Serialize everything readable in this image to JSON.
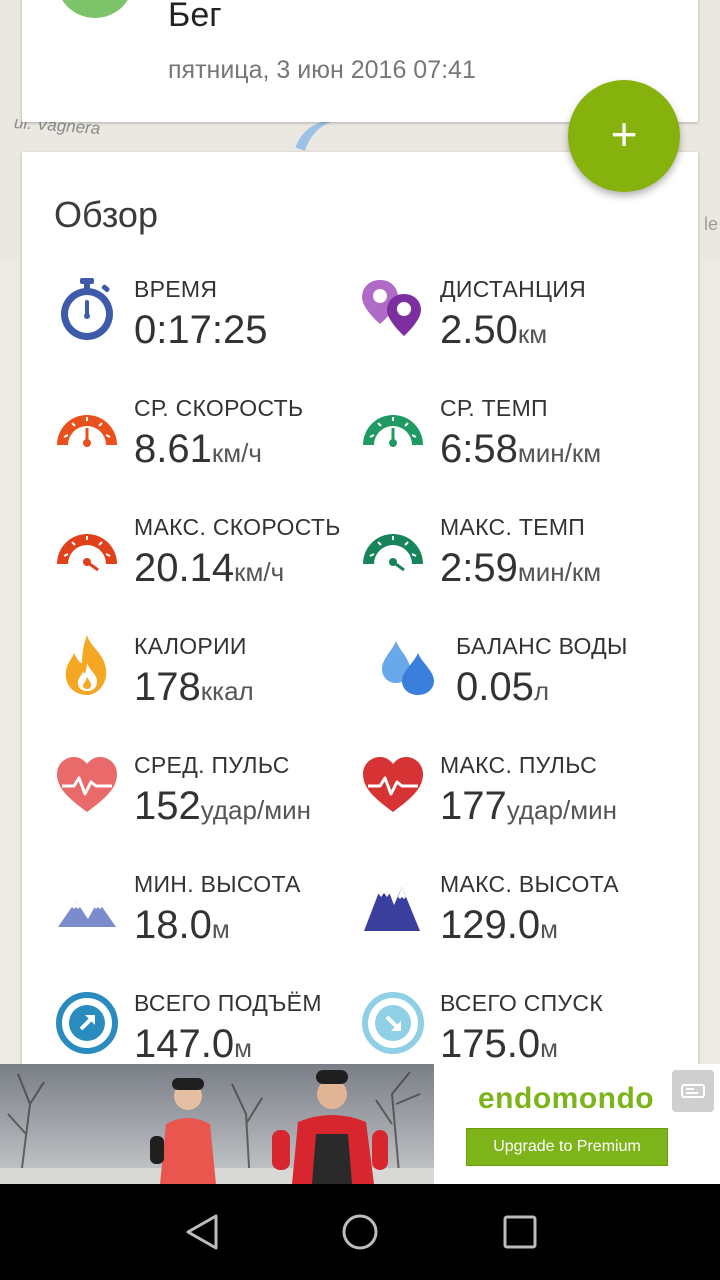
{
  "map": {
    "road_label": "ul. Vagnera",
    "edge_label": "le"
  },
  "header": {
    "sport": "Бег",
    "date": "пятница, 3 июн 2016 07:41"
  },
  "fab": {
    "label": "+"
  },
  "overview": {
    "title": "Обзор",
    "stats": [
      {
        "id": "time",
        "label": "ВРЕМЯ",
        "value": "0:17:25",
        "unit": "",
        "icon": "stopwatch-icon"
      },
      {
        "id": "distance",
        "label": "ДИСТАНЦИЯ",
        "value": "2.50",
        "unit": "км",
        "icon": "location-pins-icon"
      },
      {
        "id": "avg_speed",
        "label": "СР. СКОРОСТЬ",
        "value": "8.61",
        "unit": "км/ч",
        "icon": "speedometer-icon"
      },
      {
        "id": "avg_pace",
        "label": "СР. ТЕМП",
        "value": "6:58",
        "unit": "мин/км",
        "icon": "pace-gauge-icon"
      },
      {
        "id": "max_speed",
        "label": "МАКС. СКОРОСТЬ",
        "value": "20.14",
        "unit": "км/ч",
        "icon": "max-speedometer-icon"
      },
      {
        "id": "max_pace",
        "label": "МАКС. ТЕМП",
        "value": "2:59",
        "unit": "мин/км",
        "icon": "max-pace-gauge-icon"
      },
      {
        "id": "calories",
        "label": "КАЛОРИИ",
        "value": "178",
        "unit": "ккал",
        "icon": "flame-icon"
      },
      {
        "id": "water",
        "label": "БАЛАНС ВОДЫ",
        "value": "0.05",
        "unit": "л",
        "icon": "water-drops-icon"
      },
      {
        "id": "avg_hr",
        "label": "СРЕД. ПУЛЬС",
        "value": "152",
        "unit": "удар/мин",
        "icon": "heart-pulse-icon"
      },
      {
        "id": "max_hr",
        "label": "МАКС. ПУЛЬС",
        "value": "177",
        "unit": "удар/мин",
        "icon": "heart-pulse-max-icon"
      },
      {
        "id": "min_alt",
        "label": "МИН. ВЫСОТА",
        "value": "18.0",
        "unit": "м",
        "icon": "mountains-low-icon"
      },
      {
        "id": "max_alt",
        "label": "МАКС. ВЫСОТА",
        "value": "129.0",
        "unit": "м",
        "icon": "mountains-high-icon"
      },
      {
        "id": "ascent",
        "label": "ВСЕГО ПОДЪЁМ",
        "value": "147.0",
        "unit": "м",
        "icon": "ascent-arrow-icon"
      },
      {
        "id": "descent",
        "label": "ВСЕГО СПУСК",
        "value": "175.0",
        "unit": "м",
        "icon": "descent-arrow-icon"
      }
    ]
  },
  "ad": {
    "brand": "endomondo",
    "button": "Upgrade to Premium"
  },
  "colors": {
    "fab": "#86b20e",
    "brand_green": "#7db41a",
    "sport_circle": "#7cc36a",
    "time": "#3e5ba9",
    "distance": "#8e44ad",
    "speed": "#e8501e",
    "pace": "#1e9a62",
    "calories": "#f5a623",
    "water": "#4a90e2",
    "heart": "#e24545",
    "alt_min": "#6d7fbf",
    "alt_max": "#3a3f9e",
    "ascent": "#2a8bbf",
    "descent": "#8fd0e6"
  }
}
